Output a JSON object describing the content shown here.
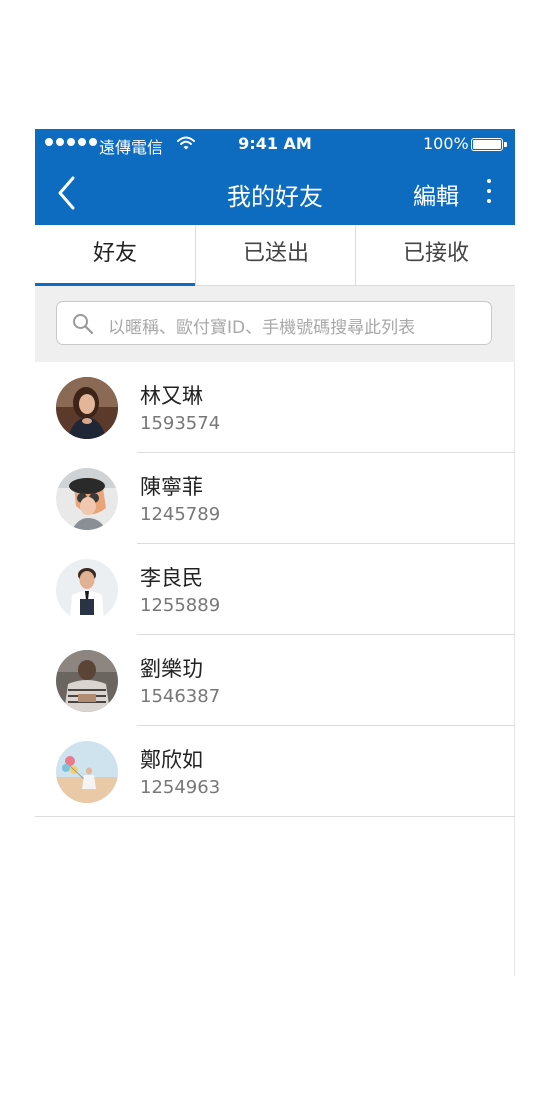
{
  "status_bar": {
    "carrier": "遠傳電信",
    "time": "9:41 AM",
    "battery": "100%"
  },
  "nav": {
    "title": "我的好友",
    "edit_label": "編輯",
    "back_icon": "chevron-left-icon",
    "more_icon": "more-vertical-icon"
  },
  "tabs": [
    {
      "label": "好友",
      "active": true
    },
    {
      "label": "已送出",
      "active": false
    },
    {
      "label": "已接收",
      "active": false
    }
  ],
  "search": {
    "placeholder": "以暱稱、歐付寶ID、手機號碼搜尋此列表",
    "icon": "search-icon"
  },
  "friends": [
    {
      "name": "林又琳",
      "id": "1593574"
    },
    {
      "name": "陳寧菲",
      "id": "1245789"
    },
    {
      "name": "李良民",
      "id": "1255889"
    },
    {
      "name": "劉樂玏",
      "id": "1546387"
    },
    {
      "name": "鄭欣如",
      "id": "1254963"
    }
  ],
  "colors": {
    "brand": "#0d6cbf",
    "search_bg": "#efefef",
    "divider": "#dcdcdc"
  }
}
